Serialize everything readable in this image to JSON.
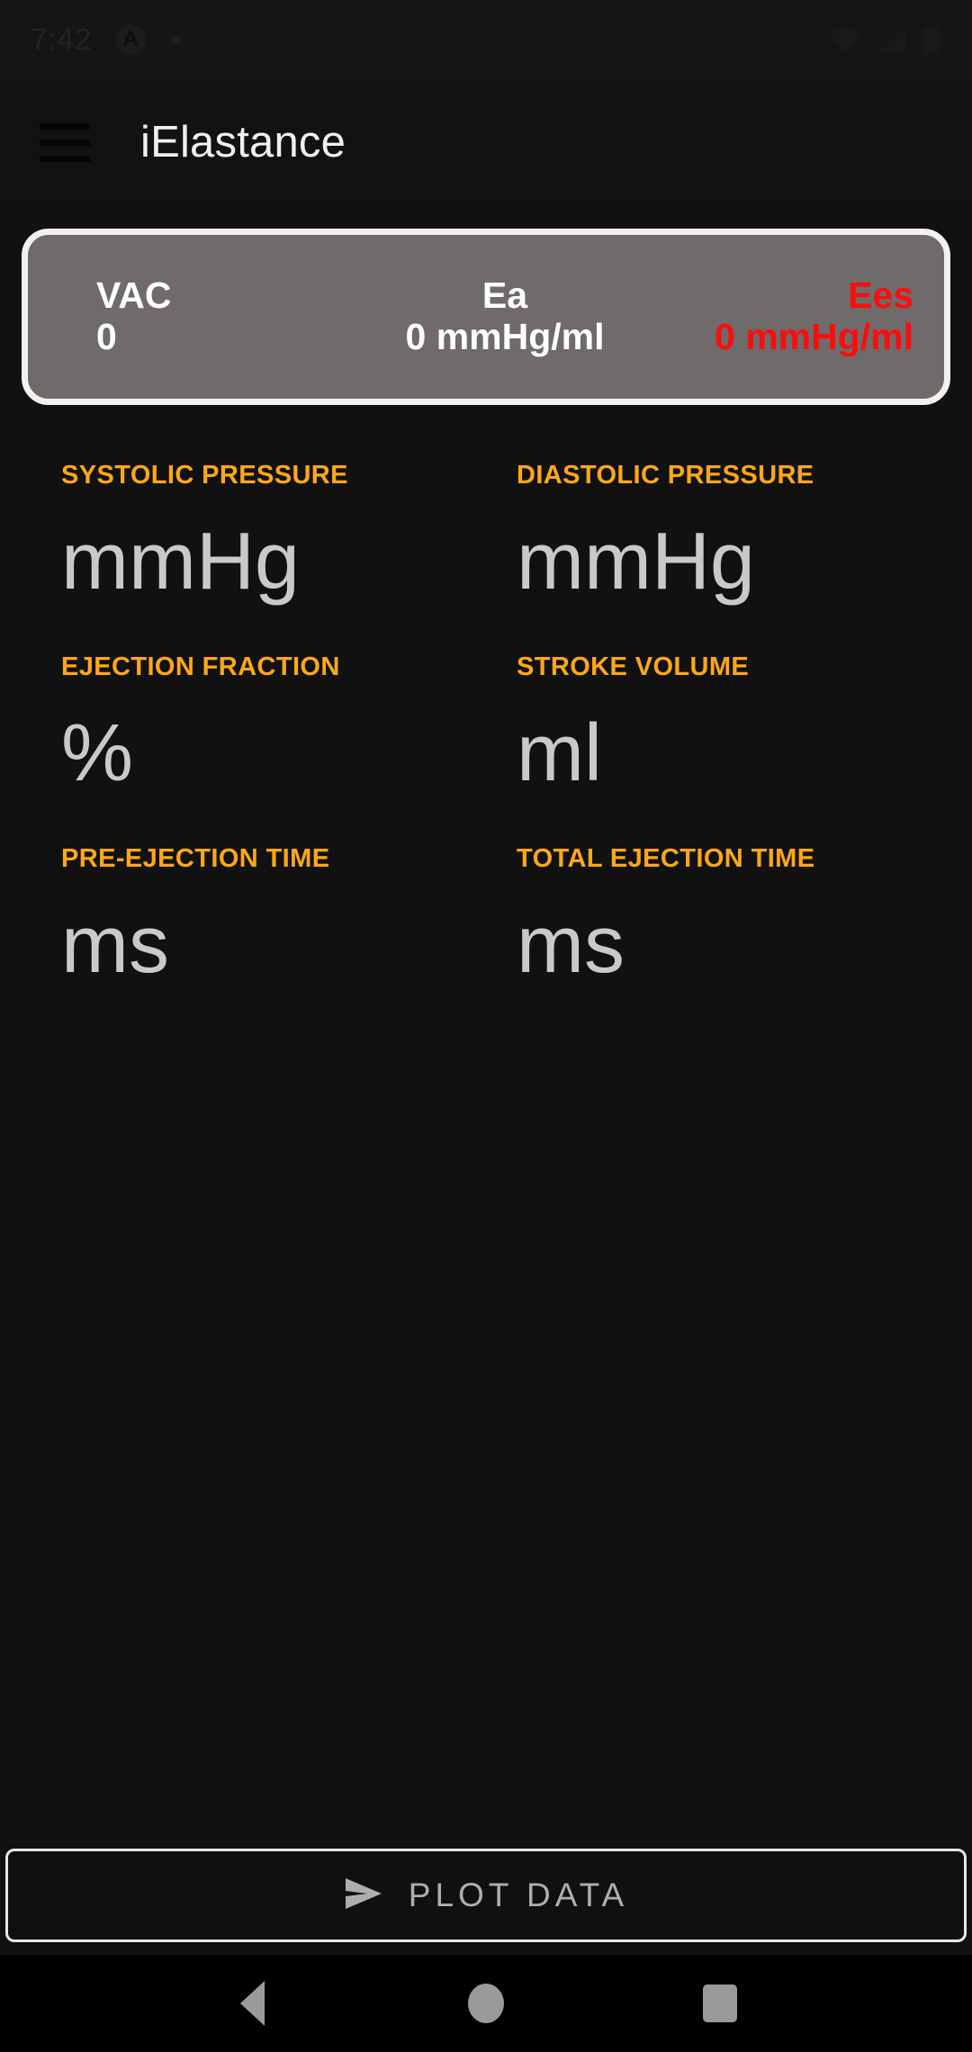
{
  "status_bar": {
    "time": "7:42",
    "app_icon": "A",
    "icons": [
      "wifi-icon",
      "cellular-signal-icon",
      "battery-icon"
    ]
  },
  "app_bar": {
    "menu_icon": "hamburger-menu-icon",
    "title": "iElastance"
  },
  "result_card": {
    "metrics": [
      {
        "label": "VAC",
        "value": "0",
        "color": "#ffffff"
      },
      {
        "label": "Ea",
        "value": "0 mmHg/ml",
        "color": "#ffffff"
      },
      {
        "label": "Ees",
        "value": "0 mmHg/ml",
        "color": "#fb0d0d"
      }
    ],
    "border_color": "#f3f0ee",
    "background_color": "#6f6b6a"
  },
  "fields": [
    {
      "label": "SYSTOLIC PRESSURE",
      "value": "",
      "suffix": "mmHg"
    },
    {
      "label": "DIASTOLIC PRESSURE",
      "value": "",
      "suffix": "mmHg"
    },
    {
      "label": "EJECTION FRACTION",
      "value": "",
      "suffix": "%"
    },
    {
      "label": "STROKE VOLUME",
      "value": "",
      "suffix": "ml"
    },
    {
      "label": "PRE-EJECTION TIME",
      "value": "",
      "suffix": "ms"
    },
    {
      "label": "TOTAL EJECTION TIME",
      "value": "",
      "suffix": "ms"
    }
  ],
  "label_color": "#ffa719",
  "plot_button": {
    "icon": "send-icon",
    "label": "PLOT DATA"
  },
  "nav_bar": {
    "back": "back-triangle-icon",
    "home": "home-circle-icon",
    "recents": "recents-square-icon"
  }
}
